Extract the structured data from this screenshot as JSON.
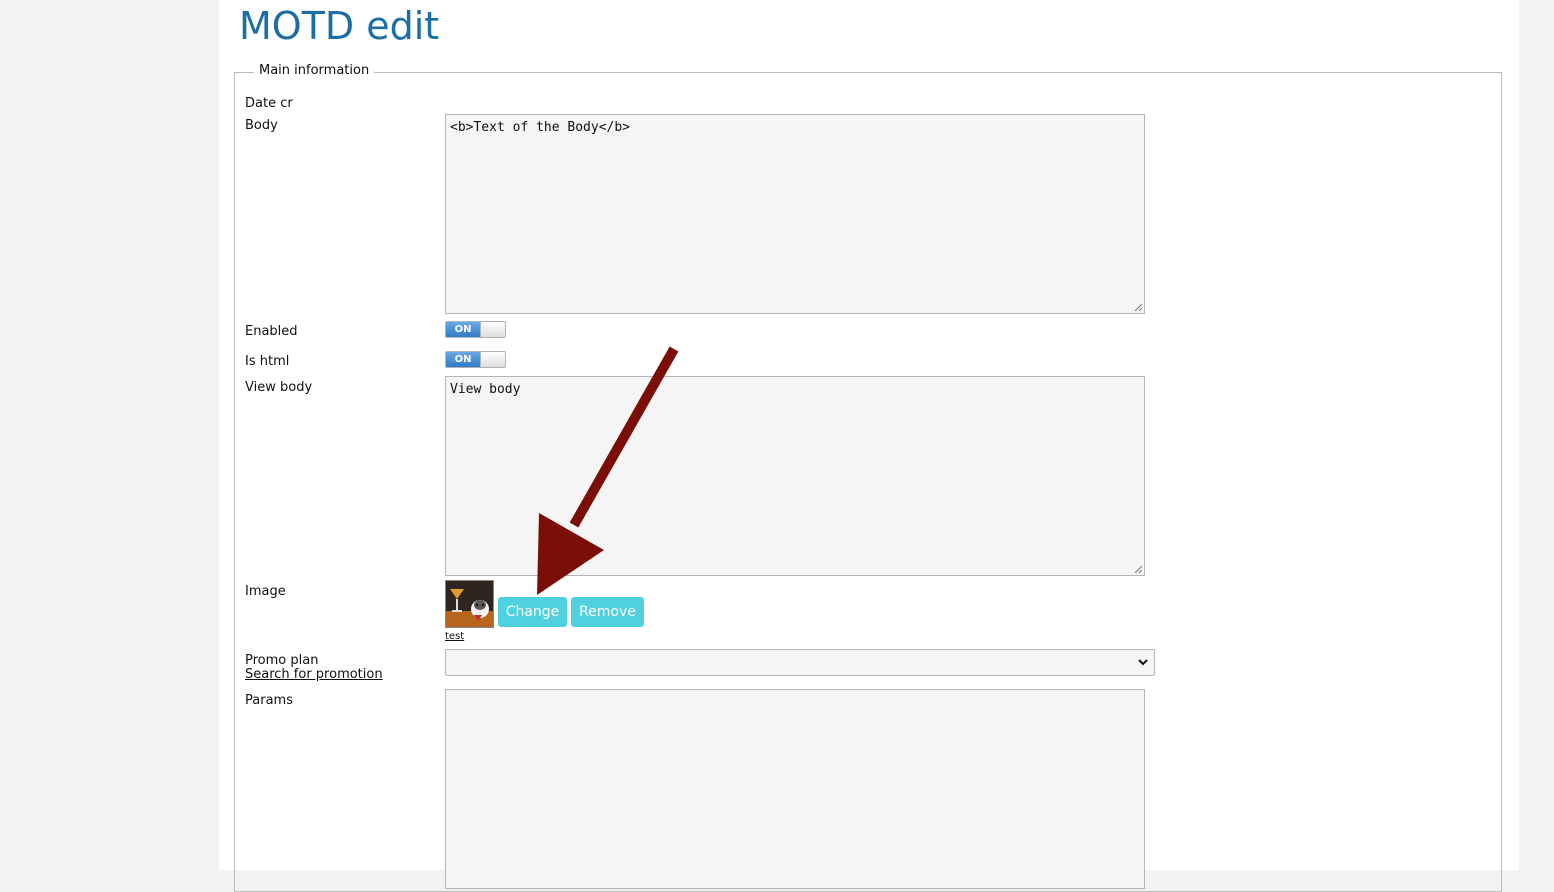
{
  "page": {
    "title": "MOTD edit"
  },
  "form": {
    "legend": "Main information",
    "date_cr_label": "Date cr",
    "body_label": "Body",
    "body_value": "<b>Text of the Body</b>",
    "enabled_label": "Enabled",
    "enabled_state": "ON",
    "is_html_label": "Is html",
    "is_html_state": "ON",
    "view_body_label": "View body",
    "view_body_value": "View body",
    "image_label": "Image",
    "image_caption": "test",
    "change_button": "Change",
    "remove_button": "Remove",
    "promo_plan_label": "Promo plan",
    "search_promotion_link": "Search for promotion",
    "promo_plan_value": "",
    "params_label": "Params",
    "params_value": ""
  },
  "colors": {
    "title": "#1c6ea4",
    "button_bg": "#4fd1df",
    "toggle_on": "#2f7bc6",
    "annotation_arrow": "#7b0e06"
  }
}
